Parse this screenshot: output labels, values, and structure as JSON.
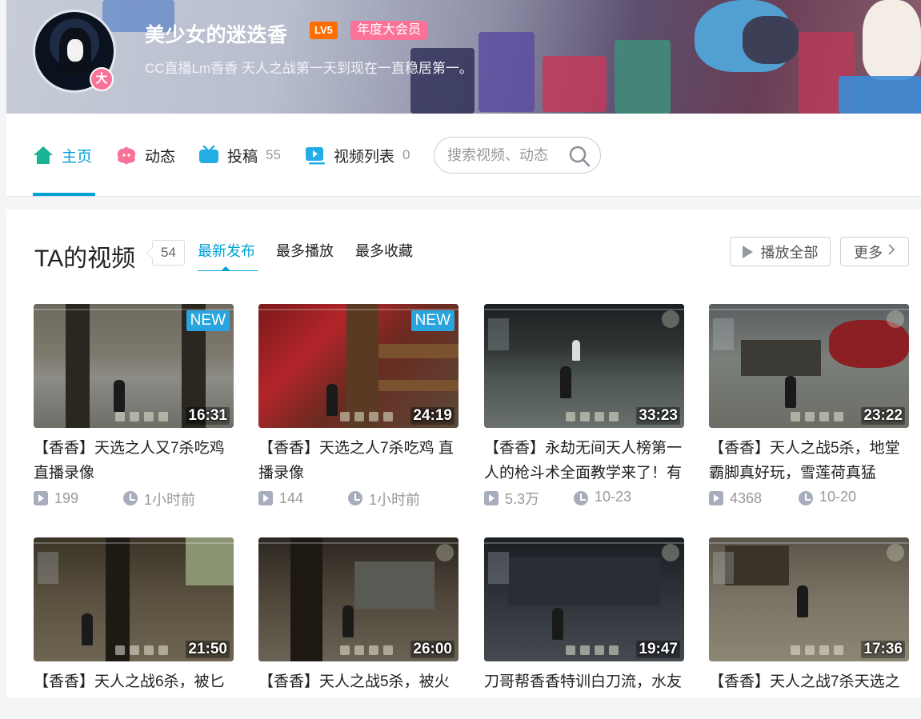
{
  "profile": {
    "username": "美少女的迷迭香",
    "level": "LV5",
    "vip": "年度大会员",
    "vip_avatar_badge": "大",
    "signature": "CC直播Lm香香 天人之战第一天到现在一直稳居第一。"
  },
  "nav": {
    "items": [
      {
        "label": "主页",
        "count": "",
        "icon": "home-icon"
      },
      {
        "label": "动态",
        "count": "",
        "icon": "dynamic-icon"
      },
      {
        "label": "投稿",
        "count": "55",
        "icon": "upload-icon"
      },
      {
        "label": "视频列表",
        "count": "0",
        "icon": "playlist-icon"
      }
    ],
    "search_placeholder": "搜索视频、动态"
  },
  "videos_section": {
    "title": "TA的视频",
    "count": "54",
    "sort_tabs": [
      "最新发布",
      "最多播放",
      "最多收藏"
    ],
    "play_all": "播放全部",
    "more": "更多"
  },
  "videos": [
    {
      "title": "【香香】天选之人又7杀吃鸡 直播录像",
      "duration": "16:31",
      "new": "NEW",
      "views": "199",
      "date": "1小时前"
    },
    {
      "title": "【香香】天选之人7杀吃鸡 直播录像",
      "duration": "24:19",
      "new": "NEW",
      "views": "144",
      "date": "1小时前"
    },
    {
      "title": "【香香】永劫无间天人榜第一人的枪斗术全面教学来了！有",
      "duration": "33:23",
      "new": "",
      "views": "5.3万",
      "date": "10-23"
    },
    {
      "title": "【香香】天人之战5杀，地堂霸脚真好玩，雪莲荷真猛",
      "duration": "23:22",
      "new": "",
      "views": "4368",
      "date": "10-20"
    },
    {
      "title": "【香香】天人之战6杀，被匕",
      "duration": "21:50",
      "new": "",
      "views": "",
      "date": ""
    },
    {
      "title": "【香香】天人之战5杀，被火",
      "duration": "26:00",
      "new": "",
      "views": "",
      "date": ""
    },
    {
      "title": "刀哥帮香香特训白刀流，水友",
      "duration": "19:47",
      "new": "",
      "views": "",
      "date": ""
    },
    {
      "title": "【香香】天人之战7杀天选之",
      "duration": "17:36",
      "new": "",
      "views": "",
      "date": ""
    }
  ],
  "colors": {
    "accent": "#00a1d6",
    "pink": "#fb7299",
    "level_orange": "#ff6c00",
    "new_tag": "#29a4de"
  }
}
